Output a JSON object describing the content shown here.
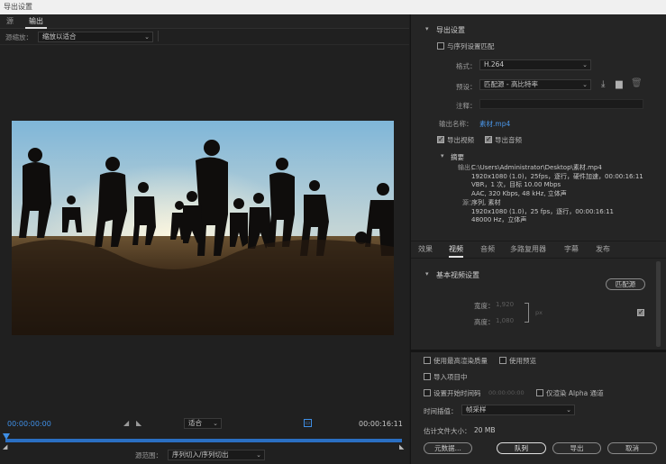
{
  "window": {
    "title": "导出设置"
  },
  "left": {
    "tabs": [
      "源",
      "输出"
    ],
    "source_scaling_label": "源缩放：",
    "source_scaling_value": "缩放以适合",
    "timecode_start": "00:00:00:00",
    "timecode_end": "00:00:16:11",
    "fit_value": "适合",
    "source_range_label": "源范围：",
    "source_range_value": "序列切入/序列切出"
  },
  "export_settings": {
    "header": "导出设置",
    "match_sequence_label": "与序列设置匹配",
    "format_label": "格式：",
    "format_value": "H.264",
    "preset_label": "预设：",
    "preset_value": "匹配源 - 高比特率",
    "comments_label": "注释：",
    "output_name_label": "输出名称：",
    "output_name_value": "素材.mp4",
    "export_video_label": "导出视频",
    "export_audio_label": "导出音频",
    "summary_header": "摘要",
    "summary_output_label": "输出：",
    "summary_output_lines": [
      "C:\\Users\\Administrator\\Desktop\\素材.mp4",
      "1920x1080 (1.0)，25fps，逐行，硬件加速，00:00:16:11",
      "VBR，1 次，目标 10.00 Mbps",
      "AAC, 320 Kbps, 48 kHz, 立体声"
    ],
    "summary_source_label": "源：",
    "summary_source_lines": [
      "序列, 素材",
      "1920x1080 (1.0)，25 fps，逐行，00:00:16:11",
      "48000 Hz，立体声"
    ]
  },
  "settings_tabs": [
    "效果",
    "视频",
    "音频",
    "多路复用器",
    "字幕",
    "发布"
  ],
  "video_settings": {
    "header": "基本视频设置",
    "match_source_button": "匹配源",
    "width_label": "宽度：",
    "width_value": "1,920",
    "height_label": "高度：",
    "height_value": "1,080",
    "unit": "px"
  },
  "bottom": {
    "use_max_render_label": "使用最高渲染质量",
    "use_previews_label": "使用预览",
    "import_into_project_label": "导入项目中",
    "set_start_tc_label": "设置开始时间码",
    "start_tc_value": "00:00:00:00",
    "render_alpha_label": "仅渲染 Alpha 通道",
    "time_interp_label": "时间插值：",
    "time_interp_value": "帧采样",
    "file_size_label": "估计文件大小：",
    "file_size_value": "20 MB",
    "metadata_button": "元数据...",
    "queue_button": "队列",
    "export_button": "导出",
    "cancel_button": "取消"
  }
}
